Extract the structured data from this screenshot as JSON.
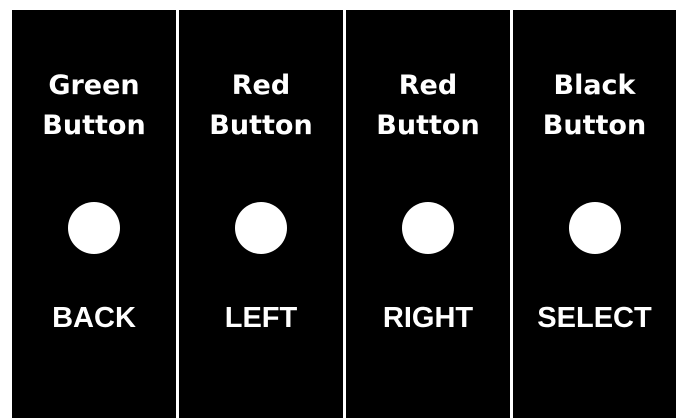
{
  "buttons": [
    {
      "title": "Green\nButton",
      "action": "BACK"
    },
    {
      "title": "Red\nButton",
      "action": "LEFT"
    },
    {
      "title": "Red\nButton",
      "action": "RIGHT"
    },
    {
      "title": "Black\nButton",
      "action": "SELECT"
    }
  ],
  "colors": {
    "panel": "#000000",
    "foreground": "#ffffff",
    "page": "#ffffff"
  }
}
